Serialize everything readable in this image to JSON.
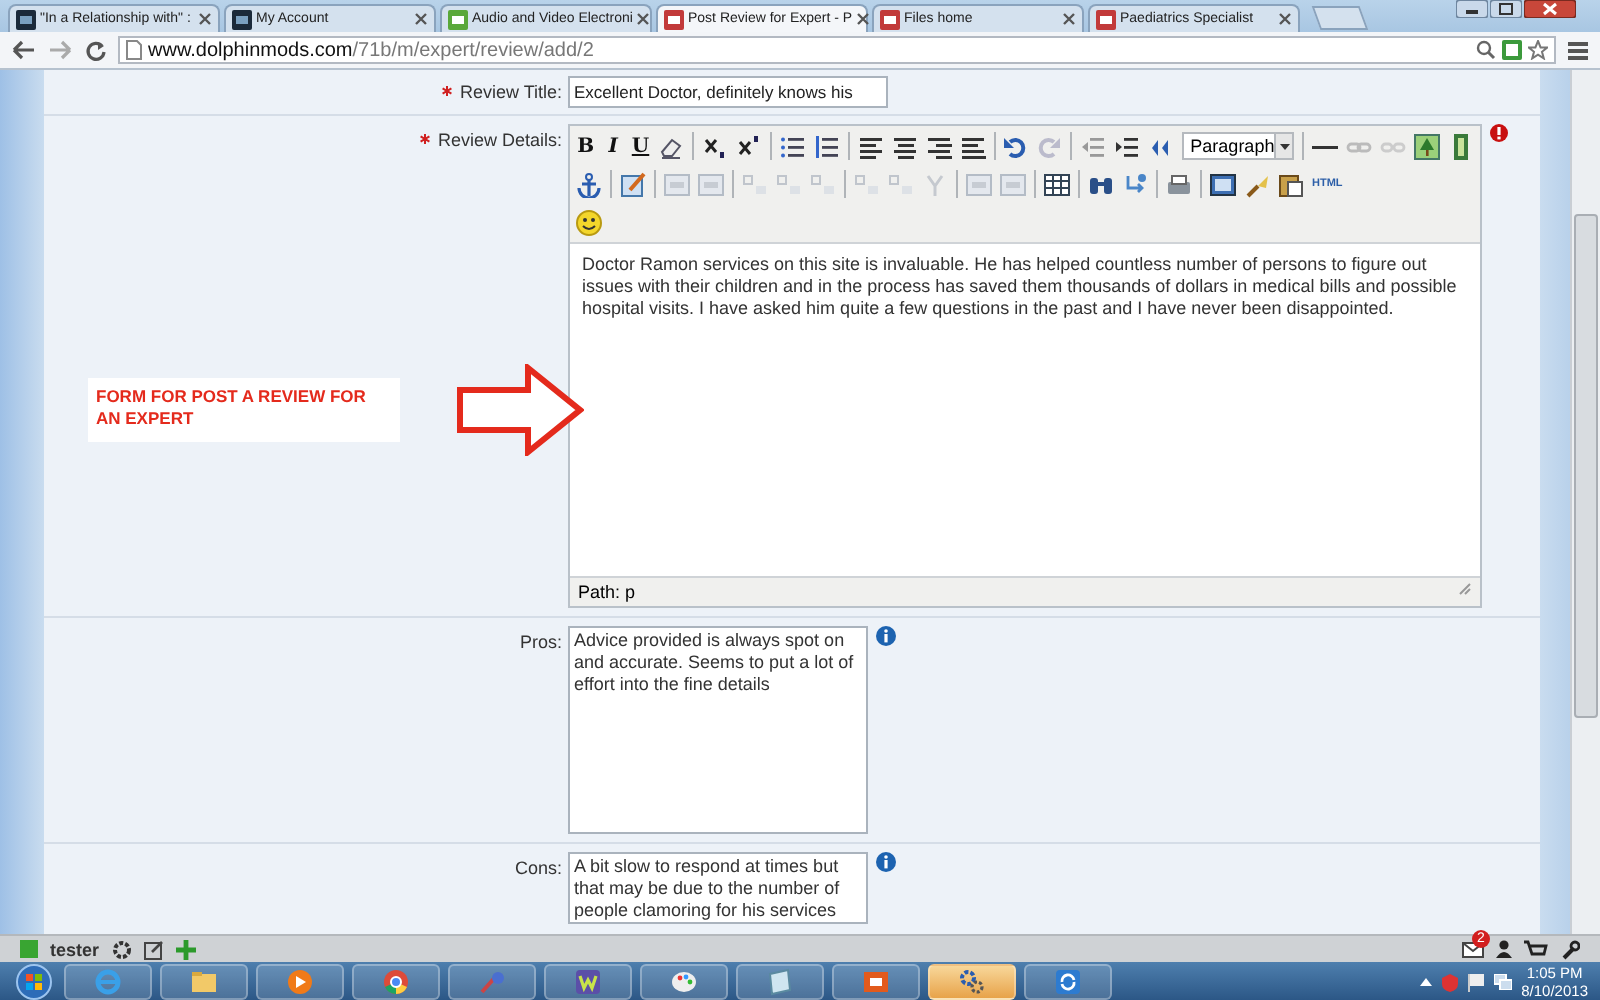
{
  "browser": {
    "tabs": [
      {
        "title": "\"In a Relationship with\" :",
        "selected": false
      },
      {
        "title": "My Account",
        "selected": false
      },
      {
        "title": "Audio and Video Electroni",
        "selected": false
      },
      {
        "title": "Post Review for Expert - P",
        "selected": true
      },
      {
        "title": "Files home",
        "selected": false
      },
      {
        "title": "Paediatrics Specialist",
        "selected": false
      }
    ],
    "address": {
      "host": "www.dolphinmods.com",
      "path": "/71b/m/expert/review/add/2"
    }
  },
  "form": {
    "review_title": {
      "label": "Review Title:",
      "required": true,
      "value": "Excellent Doctor, definitely knows his"
    },
    "review_details": {
      "label": "Review Details:",
      "required": true,
      "toolbar": {
        "bold": "B",
        "italic": "I",
        "underline": "U",
        "format": "Paragraph",
        "html": "HTML"
      },
      "text": "Doctor Ramon services on this site is invaluable. He has helped countless number of persons to figure out issues with their children and in the process has saved them thousands of dollars in medical bills and possible hospital visits. I have asked him quite a few questions in the past and I have never been disappointed.",
      "path": "Path: p"
    },
    "pros": {
      "label": "Pros:",
      "required": false,
      "value": "Advice provided is always spot on and accurate. Seems to put a lot of effort into the fine details"
    },
    "cons": {
      "label": "Cons:",
      "required": false,
      "value": "A bit slow to respond at times but that may be due to the number of people clamoring for his services"
    }
  },
  "annotation": {
    "text": "FORM FOR POST A REVIEW FOR AN EXPERT"
  },
  "site_toolbar": {
    "user": "tester",
    "mail_badge": "2"
  },
  "taskbar": {
    "time": "1:05 PM",
    "date": "8/10/2013"
  }
}
